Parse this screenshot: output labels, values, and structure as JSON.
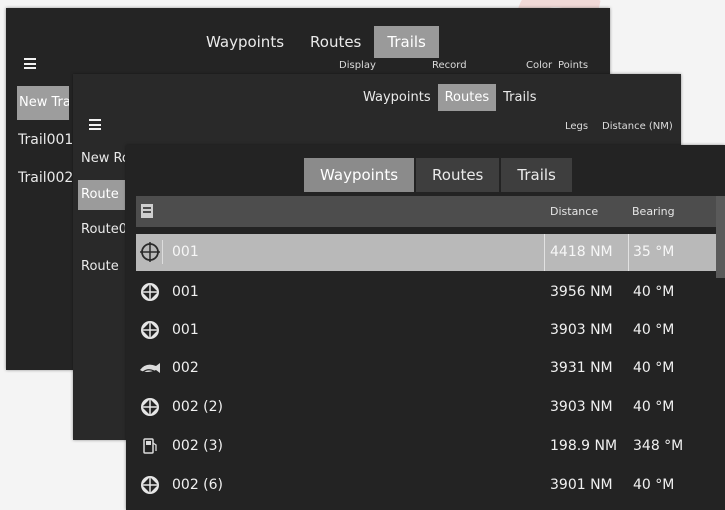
{
  "back_panel": {
    "tabs": [
      "Waypoints",
      "Routes",
      "Trails"
    ],
    "active_tab": "Trails",
    "menu_icon": "hamburger-menu-icon",
    "columns": [
      "Display",
      "Record",
      "Color",
      "Points"
    ],
    "new_button": "New Tra",
    "items": [
      "Trail001",
      "Trail002"
    ]
  },
  "middle_panel": {
    "tabs": [
      "Waypoints",
      "Routes",
      "Trails"
    ],
    "active_tab": "Routes",
    "menu_icon": "hamburger-menu-icon",
    "columns": [
      "Legs",
      "Distance (NM)"
    ],
    "new_button": "New Ro",
    "items": [
      "Route",
      "Route0",
      "Route"
    ]
  },
  "front_panel": {
    "tabs": [
      "Waypoints",
      "Routes",
      "Trails"
    ],
    "active_tab": "Waypoints",
    "header": {
      "sort_icon": "sort-list-icon",
      "distance": "Distance",
      "bearing": "Bearing"
    },
    "rows": [
      {
        "icon": "crosshair-waypoint-icon",
        "name": "001",
        "distance": "4418 NM",
        "bearing": "35 °M",
        "selected": true
      },
      {
        "icon": "diamond-waypoint-icon",
        "name": "001",
        "distance": "3956 NM",
        "bearing": "40 °M"
      },
      {
        "icon": "diamond-waypoint-icon",
        "name": "001",
        "distance": "3903 NM",
        "bearing": "40 °M"
      },
      {
        "icon": "fish-waypoint-icon",
        "name": "002",
        "distance": "3931 NM",
        "bearing": "40 °M"
      },
      {
        "icon": "diamond-waypoint-icon",
        "name": "002 (2)",
        "distance": "3903 NM",
        "bearing": "40 °M"
      },
      {
        "icon": "fuel-waypoint-icon",
        "name": "002 (3)",
        "distance": "198.9 NM",
        "bearing": "348 °M"
      },
      {
        "icon": "diamond-waypoint-icon",
        "name": "002 (6)",
        "distance": "3901 NM",
        "bearing": "40 °M"
      }
    ]
  },
  "colors": {
    "panel_bg": "#242424",
    "active_tab_bg": "#9a9a9a",
    "selected_row_bg": "#b9b9b9",
    "watermark": "#d72814"
  }
}
